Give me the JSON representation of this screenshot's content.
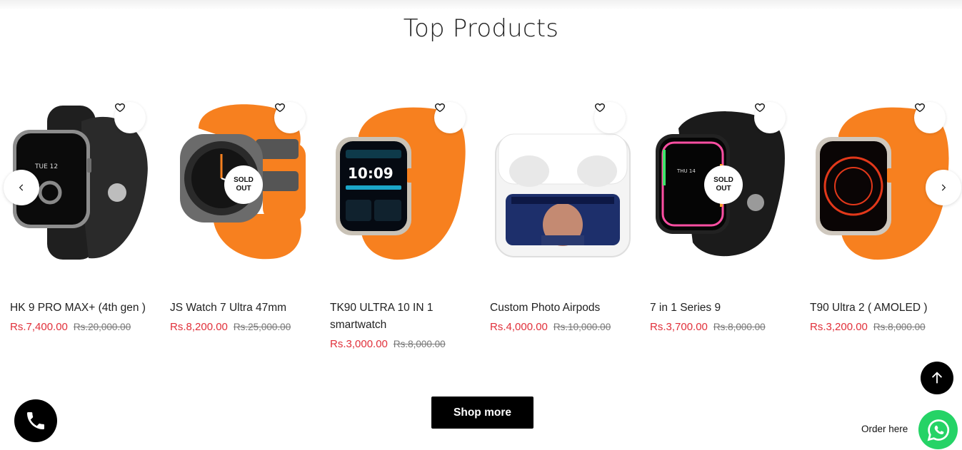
{
  "section": {
    "title": "Top Products"
  },
  "products": [
    {
      "title": "HK 9 PRO MAX+ (4th gen )",
      "price": "Rs.7,400.00",
      "compare_price": "Rs.20,000.00",
      "sold_out": false
    },
    {
      "title": "JS Watch 7 Ultra 47mm",
      "price": "Rs.8,200.00",
      "compare_price": "Rs.25,000.00",
      "sold_out": true,
      "sold_label": "SOLD OUT"
    },
    {
      "title": "TK90 ULTRA 10 IN 1 smartwatch",
      "price": "Rs.3,000.00",
      "compare_price": "Rs.8,000.00",
      "sold_out": false
    },
    {
      "title": "Custom Photo Airpods",
      "price": "Rs.4,000.00",
      "compare_price": "Rs.10,000.00",
      "sold_out": false
    },
    {
      "title": "7 in 1 Series 9",
      "price": "Rs.3,700.00",
      "compare_price": "Rs.8,000.00",
      "sold_out": true,
      "sold_label": "SOLD OUT"
    },
    {
      "title": "T90 Ultra 2 ( AMOLED )",
      "price": "Rs.3,200.00",
      "compare_price": "Rs.8,000.00",
      "sold_out": false
    }
  ],
  "watch_faces": {
    "hk9_date": "TUE 12",
    "tk90_time": "10:09",
    "series9_date": "THU 14"
  },
  "actions": {
    "shop_more": "Shop more",
    "order_here": "Order here"
  },
  "icons": {
    "wishlist": "heart-icon",
    "prev": "chevron-left-icon",
    "next": "chevron-right-icon",
    "scroll_top": "arrow-up-icon",
    "call": "phone-icon",
    "chat": "whatsapp-icon"
  },
  "colors": {
    "sale_price": "#e1303a",
    "button": "#000000",
    "whatsapp": "#25d366",
    "band_orange": "#f7801f"
  }
}
